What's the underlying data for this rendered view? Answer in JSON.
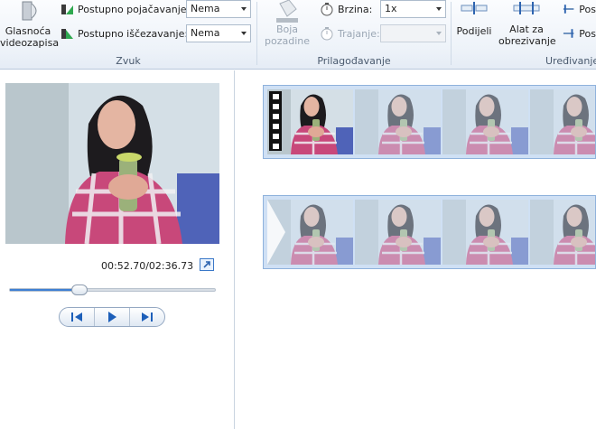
{
  "ribbon": {
    "audio": {
      "volume_label_line1": "Glasnoća",
      "volume_label_line2": "videozapisa",
      "fade_in_label": "Postupno pojačavanje:",
      "fade_in_value": "Nema",
      "fade_out_label": "Postupno iščezavanje:",
      "fade_out_value": "Nema",
      "group_label": "Zvuk"
    },
    "adjust": {
      "bg_color_line1": "Boja",
      "bg_color_line2": "pozadine",
      "speed_label": "Brzina:",
      "speed_value": "1x",
      "duration_label": "Trajanje:",
      "duration_value": "",
      "group_label": "Prilagođavanje"
    },
    "edit": {
      "split_label": "Podijeli",
      "trim_line1": "Alat za",
      "trim_line2": "obrezivanje",
      "set_start_label": "Pos",
      "set_end_label": "Pos",
      "group_label": "Uređivanje"
    }
  },
  "preview": {
    "timecode": "00:52.70/02:36.73",
    "seek_progress": 0.34
  },
  "colors": {
    "accent": "#3d7fd3",
    "clip_border": "#8fb2dc",
    "clip_bg": "#cfe0f4"
  }
}
